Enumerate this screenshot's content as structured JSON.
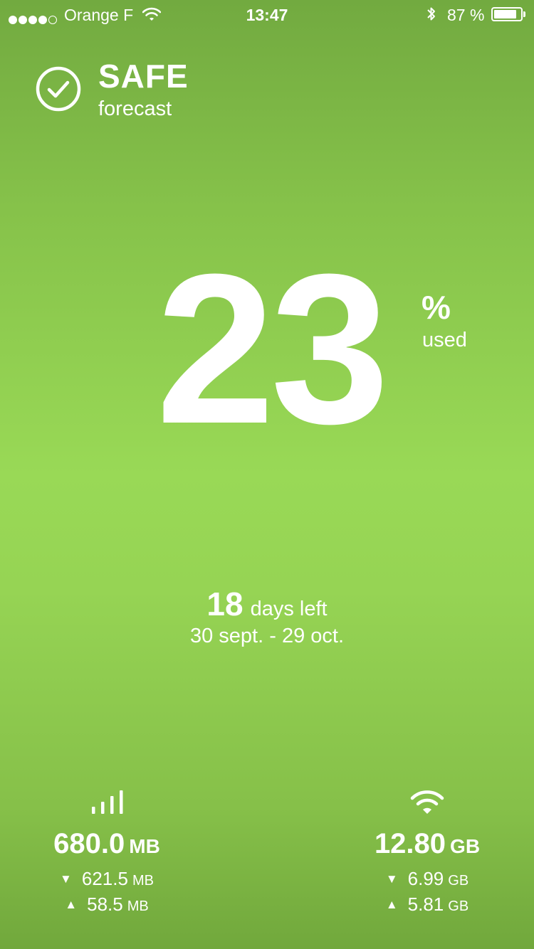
{
  "status_bar": {
    "signal_strength_filled": 4,
    "signal_strength_total": 5,
    "carrier": "Orange F",
    "time": "13:47",
    "battery_percent_text": "87 %",
    "battery_level": 0.87
  },
  "forecast": {
    "status": "SAFE",
    "label": "forecast",
    "icon": "check-circle-icon"
  },
  "usage": {
    "percent": "23",
    "unit": "%",
    "label": "used"
  },
  "cycle": {
    "days_left": "18",
    "days_left_label": "days left",
    "range": "30 sept. - 29 oct."
  },
  "cellular": {
    "icon": "cellular-bars-icon",
    "total_value": "680.0",
    "total_unit": "MB",
    "download_value": "621.5",
    "download_unit": "MB",
    "upload_value": "58.5",
    "upload_unit": "MB"
  },
  "wifi": {
    "icon": "wifi-icon",
    "total_value": "12.80",
    "total_unit": "GB",
    "download_value": "6.99",
    "download_unit": "GB",
    "upload_value": "5.81",
    "upload_unit": "GB"
  },
  "colors": {
    "background_top": "#72aa40",
    "background_mid": "#99d956",
    "background_bottom": "#71a83c",
    "text": "#ffffff"
  }
}
